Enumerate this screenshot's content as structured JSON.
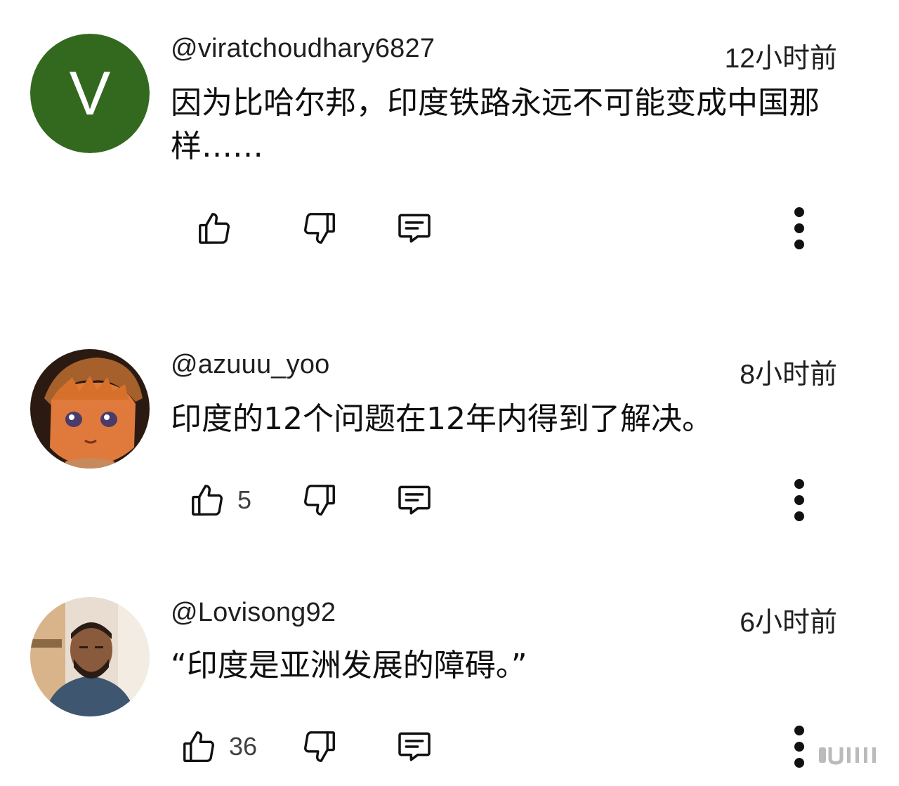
{
  "comments": [
    {
      "avatar_letter": "V",
      "author": "@viratchoudhary6827",
      "time": "12小时前",
      "text": "因为比哈尔邦，印度铁路永远不可能变成中国那样……",
      "like_count": ""
    },
    {
      "author": "@azuuu_yoo",
      "time": "8小时前",
      "text": "印度的12个问题在12年内得到了解决。",
      "like_count": "5"
    },
    {
      "author": "@Lovisong92",
      "time": "6小时前",
      "text": "“印度是亚洲发展的障碍。”",
      "like_count": "36"
    }
  ],
  "icons": {
    "like": "thumb-up-icon",
    "dislike": "thumb-down-icon",
    "reply": "comment-icon",
    "more": "more-vertical-icon"
  },
  "colors": {
    "avatar_green": "#33691e",
    "text": "#0f0f0f",
    "secondary": "#404040"
  }
}
